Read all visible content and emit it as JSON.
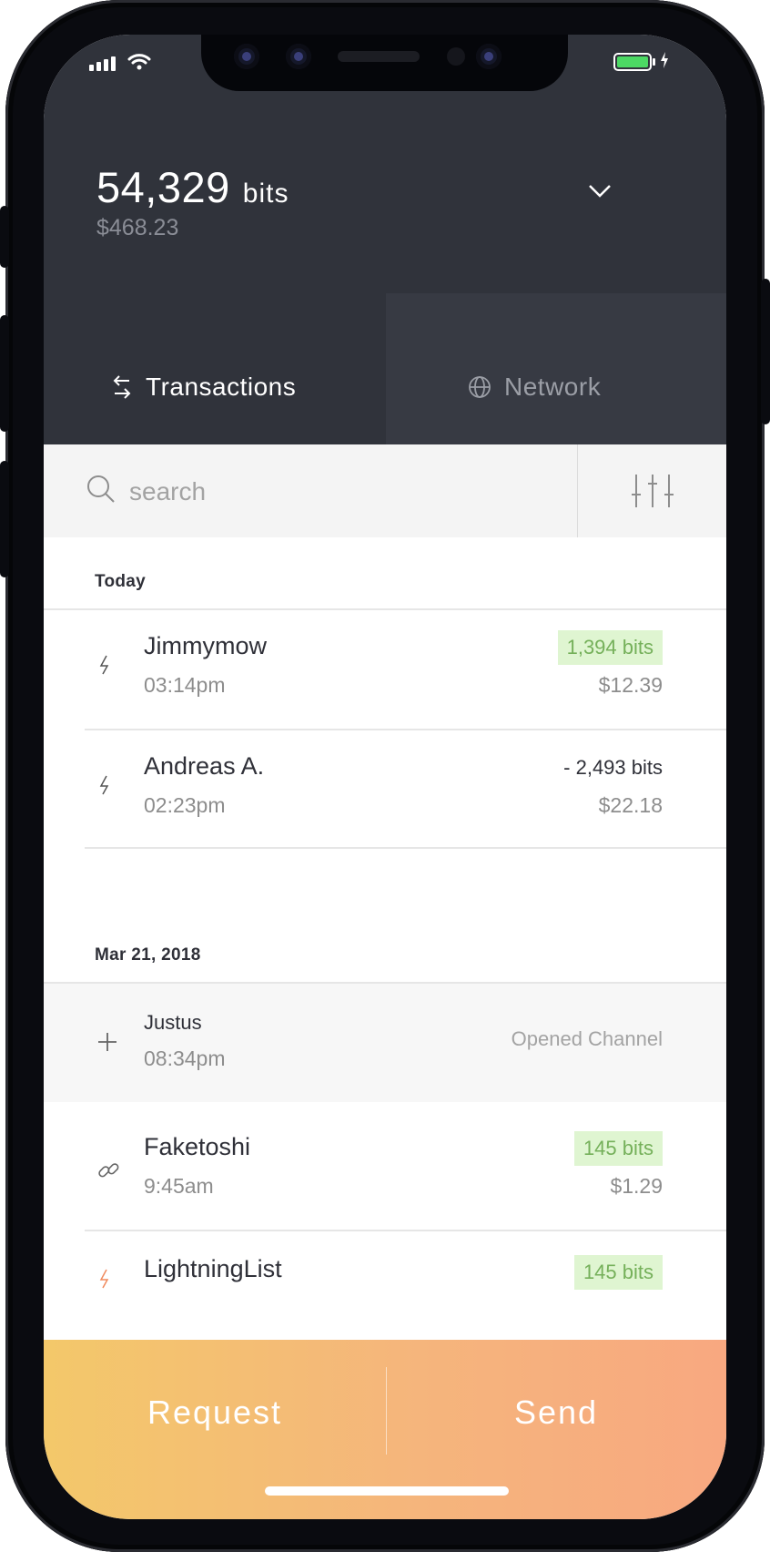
{
  "header": {
    "balance_amount": "54,329",
    "balance_unit": "bits",
    "balance_fiat": "$468.23"
  },
  "tabs": [
    {
      "label": "Transactions",
      "active": true
    },
    {
      "label": "Network",
      "active": false
    }
  ],
  "search": {
    "placeholder": "search"
  },
  "groups": [
    {
      "title": "Today",
      "items": [
        {
          "icon": "lightning-icon",
          "name": "Jimmymow",
          "time": "03:14pm",
          "amount": "1,394 bits",
          "fiat": "$12.39",
          "direction": "incoming"
        },
        {
          "icon": "lightning-icon",
          "name": "Andreas A.",
          "time": "02:23pm",
          "amount": "- 2,493 bits",
          "fiat": "$22.18",
          "direction": "outgoing"
        }
      ]
    },
    {
      "title": "Mar 21, 2018",
      "items": [
        {
          "icon": "plus-icon",
          "name": "Justus",
          "time": "08:34pm",
          "status": "Opened Channel"
        },
        {
          "icon": "link-icon",
          "name": "Faketoshi",
          "time": "9:45am",
          "amount": "145 bits",
          "fiat": "$1.29",
          "direction": "incoming"
        },
        {
          "icon": "lightning-icon",
          "name": "LightningList",
          "amount": "145 bits",
          "direction": "incoming"
        }
      ]
    }
  ],
  "footer": {
    "request_label": "Request",
    "send_label": "Send"
  },
  "status_bar": {
    "battery_level": 1.0
  },
  "colors": {
    "header_bg": "#30333b",
    "positive_bg": "#dff5d1",
    "positive_text": "#75b05a",
    "footer_gradient_start": "#f3c86a",
    "footer_gradient_end": "#f8a880",
    "battery": "#4cd964"
  }
}
